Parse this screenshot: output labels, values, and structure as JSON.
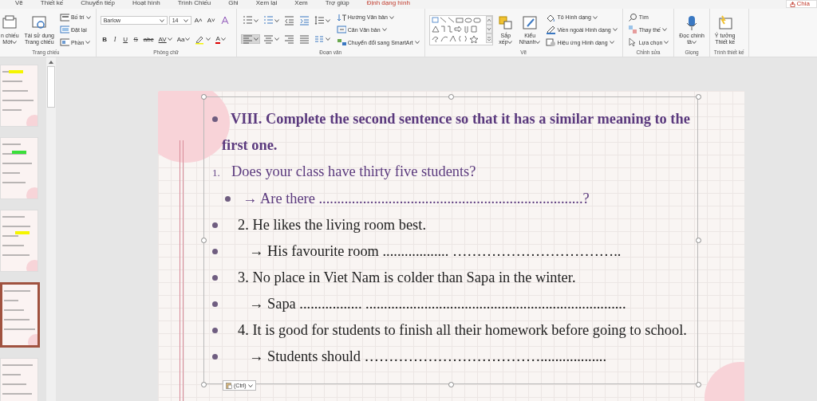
{
  "menu_tabs": [
    {
      "label": "Vẽ",
      "kind": "normal"
    },
    {
      "label": "Thiết kế",
      "kind": "normal"
    },
    {
      "label": "Chuyển tiếp",
      "kind": "normal"
    },
    {
      "label": "Hoạt hình",
      "kind": "normal"
    },
    {
      "label": "Trình Chiếu",
      "kind": "normal"
    },
    {
      "label": "Ghi",
      "kind": "normal"
    },
    {
      "label": "Xem lại",
      "kind": "normal"
    },
    {
      "label": "Xem",
      "kind": "normal"
    },
    {
      "label": "Trợ giúp",
      "kind": "normal"
    },
    {
      "label": "Định dạng hình",
      "kind": "contextual"
    }
  ],
  "share_button": "Chia",
  "ribbon": {
    "groups": [
      {
        "label": "Trang chiếu",
        "columns": [
          [
            {
              "kind": "large",
              "label": "n chiếu\nMới",
              "dropdown": true
            }
          ],
          [
            {
              "kind": "large",
              "label": "Tái sử dụng\nTrang chiếu",
              "dropdown": false
            }
          ],
          [
            {
              "kind": "small",
              "label": "Bố trí",
              "dropdown": true
            },
            {
              "kind": "small",
              "label": "Đặt lại",
              "dropdown": false
            },
            {
              "kind": "small",
              "label": "Phần",
              "dropdown": true
            }
          ]
        ]
      },
      {
        "label": "Phông chữ",
        "columns": [
          [
            {
              "kind": "toolrow",
              "tools": [
                {
                  "kind": "combo",
                  "label": "Barlow",
                  "selected": false
                },
                {
                  "kind": "combo-small",
                  "label": "14",
                  "selected": false
                },
                {
                  "kind": "text",
                  "label": "A˄",
                  "selected": false
                },
                {
                  "kind": "text",
                  "label": "A˅",
                  "selected": false
                },
                {
                  "kind": "icon",
                  "selected": false
                }
              ]
            },
            {
              "kind": "toolrow",
              "tools": [
                {
                  "kind": "text",
                  "label": "B",
                  "selected": false
                },
                {
                  "kind": "text",
                  "label": "I",
                  "selected": false
                },
                {
                  "kind": "text",
                  "label": "U",
                  "selected": false
                },
                {
                  "kind": "text",
                  "label": "S",
                  "selected": false
                },
                {
                  "kind": "text",
                  "label": "abc",
                  "selected": false
                },
                {
                  "kind": "text",
                  "label": "AV",
                  "selected": false
                },
                {
                  "kind": "text",
                  "label": "Aa",
                  "selected": false
                },
                {
                  "kind": "icon",
                  "selected": false
                },
                {
                  "kind": "text",
                  "label": "A",
                  "selected": false
                }
              ]
            }
          ]
        ]
      },
      {
        "label": "Đoạn văn",
        "columns": [
          [
            {
              "kind": "toolrow",
              "tools": [
                {
                  "kind": "icon",
                  "selected": false
                },
                {
                  "kind": "icon",
                  "selected": false
                },
                {
                  "kind": "icon",
                  "selected": false
                },
                {
                  "kind": "icon",
                  "selected": false
                },
                {
                  "kind": "icon",
                  "selected": false
                }
              ]
            },
            {
              "kind": "toolrow",
              "tools": [
                {
                  "kind": "icon",
                  "selected": true
                },
                {
                  "kind": "icon",
                  "selected": false
                },
                {
                  "kind": "icon",
                  "selected": false
                },
                {
                  "kind": "icon",
                  "selected": false
                },
                {
                  "kind": "icon",
                  "selected": false
                }
              ]
            }
          ],
          [
            {
              "kind": "small",
              "label": "Hướng Văn bản",
              "dropdown": true
            },
            {
              "kind": "small",
              "label": "Căn Văn bản",
              "dropdown": true
            },
            {
              "kind": "small",
              "label": "Chuyển đổi sang SmartArt",
              "dropdown": true
            }
          ]
        ]
      },
      {
        "label": "Vẽ",
        "columns": [
          [
            {
              "kind": "gallery"
            }
          ],
          [
            {
              "kind": "large",
              "label": "Sắp\nxếp",
              "dropdown": true
            }
          ],
          [
            {
              "kind": "large",
              "label": "Kiểu\nNhanh",
              "dropdown": true
            }
          ],
          [
            {
              "kind": "small",
              "label": "Tô Hình dạng",
              "dropdown": true
            },
            {
              "kind": "small",
              "label": "Viền ngoài Hình dạng",
              "dropdown": true
            },
            {
              "kind": "small",
              "label": "Hiệu ứng Hình dạng",
              "dropdown": true
            }
          ]
        ]
      },
      {
        "label": "Chỉnh sửa",
        "columns": [
          [
            {
              "kind": "small",
              "label": "Tìm",
              "dropdown": false
            },
            {
              "kind": "small",
              "label": "Thay thế",
              "dropdown": true
            },
            {
              "kind": "small",
              "label": "Lựa chọn",
              "dropdown": true
            }
          ]
        ]
      },
      {
        "label": "Giọng",
        "columns": [
          [
            {
              "kind": "large",
              "label": "Đọc chính\ntả",
              "dropdown": true
            }
          ]
        ]
      },
      {
        "label": "Trình thiết kế",
        "columns": [
          [
            {
              "kind": "large",
              "label": "Ý tưởng\nThiết kế",
              "dropdown": false
            }
          ]
        ]
      }
    ]
  },
  "thumbnails": [
    {
      "selected": false
    },
    {
      "selected": false
    },
    {
      "selected": false
    },
    {
      "selected": true
    },
    {
      "selected": false
    }
  ],
  "slide": {
    "lines": [
      {
        "kind": "heading",
        "text": "VIII. Complete the second sentence so that it has a similar meaning to the first one."
      },
      {
        "kind": "numbered",
        "marker": "1.",
        "text": "Does your class have thirty five students?"
      },
      {
        "kind": "sub-bullet",
        "text": "→ Are there ........................................................................?"
      },
      {
        "kind": "question",
        "text": "2. He likes the living room best."
      },
      {
        "kind": "answer",
        "text": "→ His favourite room .................. …………………………….."
      },
      {
        "kind": "question",
        "text": "3. No place in Viet Nam is colder than Sapa in the winter."
      },
      {
        "kind": "answer",
        "text": "→ Sapa ................. ......................................................................."
      },
      {
        "kind": "question",
        "text": "4. It is good for students to finish all their homework before going to school."
      },
      {
        "kind": "answer",
        "text": "→ Students should  ……………………………….................."
      }
    ],
    "paste_options": "(Ctrl)"
  }
}
